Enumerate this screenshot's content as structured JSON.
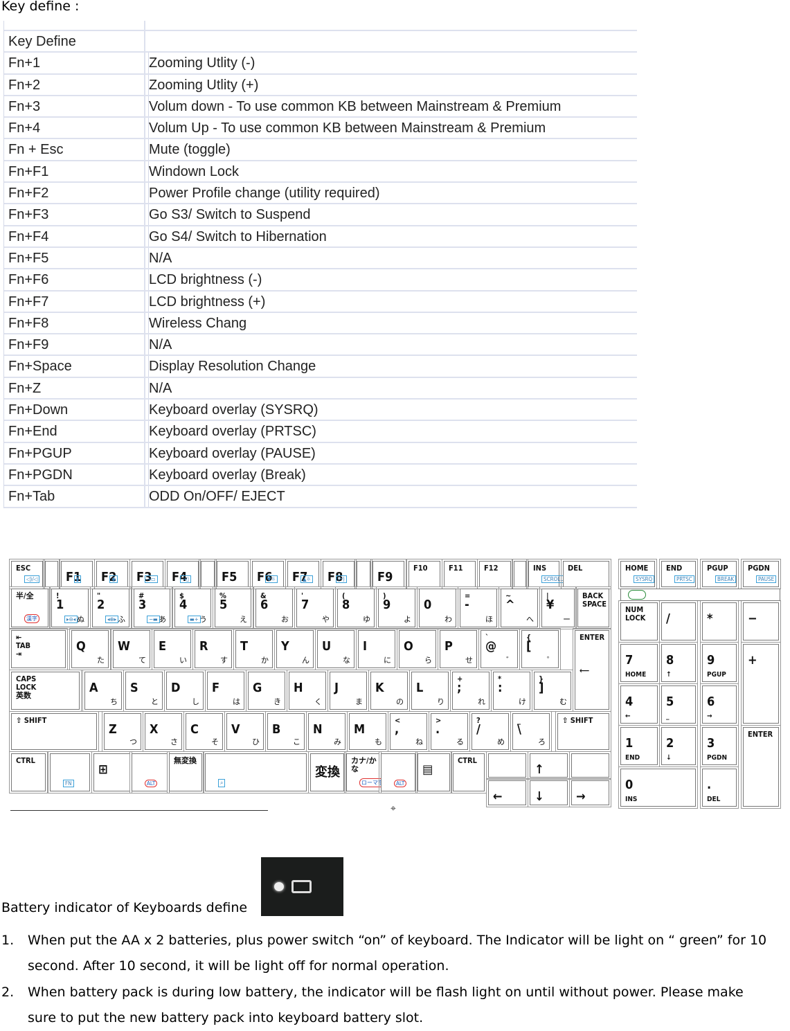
{
  "heading": "Key define :",
  "table": {
    "header": "Key Define",
    "rows": [
      [
        "Fn+1",
        "Zooming Utlity (-)"
      ],
      [
        "Fn+2",
        "Zooming Utlity (+)"
      ],
      [
        "Fn+3",
        "Volum down - To use common KB between Mainstream & Premium"
      ],
      [
        "Fn+4",
        "Volum Up - To use common KB between Mainstream & Premium"
      ],
      [
        "Fn + Esc",
        "Mute (toggle)"
      ],
      [
        "Fn+F1",
        "Windown Lock"
      ],
      [
        "Fn+F2",
        "Power Profile change (utility required)"
      ],
      [
        "Fn+F3",
        "Go S3/ Switch to Suspend"
      ],
      [
        "Fn+F4",
        "Go S4/ Switch to Hibernation"
      ],
      [
        "Fn+F5",
        "N/A"
      ],
      [
        "Fn+F6",
        "LCD brightness (-)"
      ],
      [
        "Fn+F7",
        "LCD brightness (+)"
      ],
      [
        "Fn+F8",
        "Wireless Chang"
      ],
      [
        "Fn+F9",
        "N/A"
      ],
      [
        "Fn+Space",
        "Display Resolution Change"
      ],
      [
        "Fn+Z",
        "N/A"
      ],
      [
        "Fn+Down",
        "Keyboard overlay (SYSRQ)"
      ],
      [
        "Fn+End",
        "Keyboard overlay (PRTSC)"
      ],
      [
        "Fn+PGUP",
        "Keyboard overlay (PAUSE)"
      ],
      [
        "Fn+PGDN",
        "Keyboard overlay (Break)"
      ],
      [
        "Fn+Tab",
        "ODD On/OFF/ EJECT"
      ]
    ]
  },
  "keyboard": {
    "keys": [
      {
        "m": "ESC",
        "b": "◁)/◁"
      },
      {},
      {
        "m": "F1",
        "b": "▮"
      },
      {
        "m": "F2",
        "b": "◉"
      },
      {
        "m": "F3",
        "b": "→▭"
      },
      {
        "m": "F4",
        "b": "→▯"
      },
      {},
      {
        "m": "F5"
      },
      {
        "m": "F6",
        "b": "▼☼"
      },
      {
        "m": "F7",
        "b": "▲☼"
      },
      {
        "m": "F8",
        "b": "(•)"
      },
      {},
      {
        "m": "F9"
      },
      {
        "m": "F10"
      },
      {
        "m": "F11"
      },
      {
        "m": "F12"
      },
      {},
      {
        "m": "INS",
        "b": "SCROLL LOCK"
      },
      {
        "m": "DEL"
      },
      {
        "m": "HOME",
        "b": "SYSRQ"
      },
      {
        "m": "END",
        "b": "PRTSC"
      },
      {
        "m": "PGUP",
        "b": "BREAK"
      },
      {
        "m": "PGDN",
        "b": "PAUSE"
      },
      {
        "m": "半/全",
        "r": "漢字"
      },
      {
        "t": "!",
        "m": "1",
        "k": "ぬ",
        "b": "▸⊖◂"
      },
      {
        "t": "\"",
        "m": "2",
        "k": "ふ",
        "b": "◂⊕▸"
      },
      {
        "t": "#",
        "m": "3",
        "k": "あ",
        "b": "−▬"
      },
      {
        "t": "$",
        "m": "4",
        "k": "う",
        "b": "▬+"
      },
      {
        "t": "%",
        "m": "5",
        "k": "え"
      },
      {
        "t": "&",
        "m": "6",
        "k": "お"
      },
      {
        "t": "'",
        "m": "7",
        "k": "や"
      },
      {
        "t": "(",
        "m": "8",
        "k": "ゆ"
      },
      {
        "t": ")",
        "m": "9",
        "k": "よ"
      },
      {
        "m": "0",
        "k": "わ"
      },
      {
        "t": "=",
        "m": "-",
        "k": "ほ"
      },
      {
        "t": "~",
        "m": "^",
        "k": "へ"
      },
      {
        "t": "|",
        "m": "¥",
        "k": "ー"
      },
      {
        "m": "BACK\nSPACE"
      },
      {
        "m": "NUM\nLOCK"
      },
      {
        "m": "/"
      },
      {
        "m": "*"
      },
      {
        "m": "−"
      },
      {
        "m": "⇤\nTAB\n⇥"
      },
      {
        "m": "Q",
        "k": "た"
      },
      {
        "m": "W",
        "k": "て"
      },
      {
        "m": "E",
        "k": "い"
      },
      {
        "m": "R",
        "k": "す"
      },
      {
        "m": "T",
        "k": "か"
      },
      {
        "m": "Y",
        "k": "ん"
      },
      {
        "m": "U",
        "k": "な"
      },
      {
        "m": "I",
        "k": "に"
      },
      {
        "m": "O",
        "k": "ら"
      },
      {
        "m": "P",
        "k": "せ"
      },
      {
        "t": "`",
        "m": "@",
        "k": "゛"
      },
      {
        "t": "{",
        "m": "[",
        "k": "゜"
      },
      {
        "m": "ENTER\n\n\n\n⟵"
      },
      {
        "m": "7",
        "s2": "HOME"
      },
      {
        "m": "8",
        "s2": "↑"
      },
      {
        "m": "9",
        "s2": "PGUP"
      },
      {
        "m": "+"
      },
      {
        "m": "CAPS\nLOCK\n英数"
      },
      {
        "m": "A",
        "k": "ち"
      },
      {
        "m": "S",
        "k": "と"
      },
      {
        "m": "D",
        "k": "し"
      },
      {
        "m": "F",
        "k": "は"
      },
      {
        "m": "G",
        "k": "き"
      },
      {
        "m": "H",
        "k": "く"
      },
      {
        "m": "J",
        "k": "ま"
      },
      {
        "m": "K",
        "k": "の"
      },
      {
        "m": "L",
        "k": "り"
      },
      {
        "t": "+",
        "m": ";",
        "k": "れ"
      },
      {
        "t": "*",
        "m": ":",
        "k": "け"
      },
      {
        "t": "}",
        "m": "]",
        "k": "む"
      },
      {
        "m": "4",
        "s2": "←"
      },
      {
        "m": "5",
        "s2": "_"
      },
      {
        "m": "6",
        "s2": "→"
      },
      {
        "m": "⇧ SHIFT"
      },
      {
        "m": "Z",
        "k": "つ"
      },
      {
        "m": "X",
        "k": "さ"
      },
      {
        "m": "C",
        "k": "そ"
      },
      {
        "m": "V",
        "k": "ひ"
      },
      {
        "m": "B",
        "k": "こ"
      },
      {
        "m": "N",
        "k": "み"
      },
      {
        "m": "M",
        "k": "も"
      },
      {
        "t": "<",
        "m": ",",
        "k": "ね"
      },
      {
        "t": ">",
        "m": ".",
        "k": "る"
      },
      {
        "t": "?",
        "m": "/",
        "k": "め"
      },
      {
        "t": "_",
        "m": "\\",
        "k": "ろ"
      },
      {
        "m": "⇧ SHIFT"
      },
      {
        "m": "1",
        "s2": "END"
      },
      {
        "m": "2",
        "s2": "↓"
      },
      {
        "m": "3",
        "s2": "PGDN"
      },
      {
        "m": "ENTER"
      },
      {
        "m": "CTRL"
      },
      {
        "b": "FN"
      },
      {
        "m": "⊞"
      },
      {
        "r": "ALT"
      },
      {
        "m": "無変換"
      },
      {
        "b": "⌕"
      },
      {
        "m": "変換"
      },
      {
        "m": "カナ/かな",
        "r": "ローマ字"
      },
      {
        "r": "ALT"
      },
      {
        "m": "▤"
      },
      {
        "m": "CTRL"
      },
      {},
      {
        "m": "↑"
      },
      {},
      {
        "m": "←"
      },
      {
        "m": "↓"
      },
      {
        "m": "→"
      },
      {
        "m": "0",
        "s2": "INS"
      },
      {
        "m": ".",
        "s2": "DEL"
      }
    ]
  },
  "battery": {
    "label": "Battery indicator of Keyboards define"
  },
  "notes": [
    {
      "n": "1.",
      "text": "When put the AA x 2 batteries, plus power switch “on” of keyboard.    The Indicator will be light on “ green” for 10 second.    After 10 second, it will be light off for normal operation."
    },
    {
      "n": "2.",
      "text": "When battery pack is during low battery, the indicator will be flash light on until without power. Please make sure to put the new battery pack into keyboard battery slot."
    }
  ]
}
